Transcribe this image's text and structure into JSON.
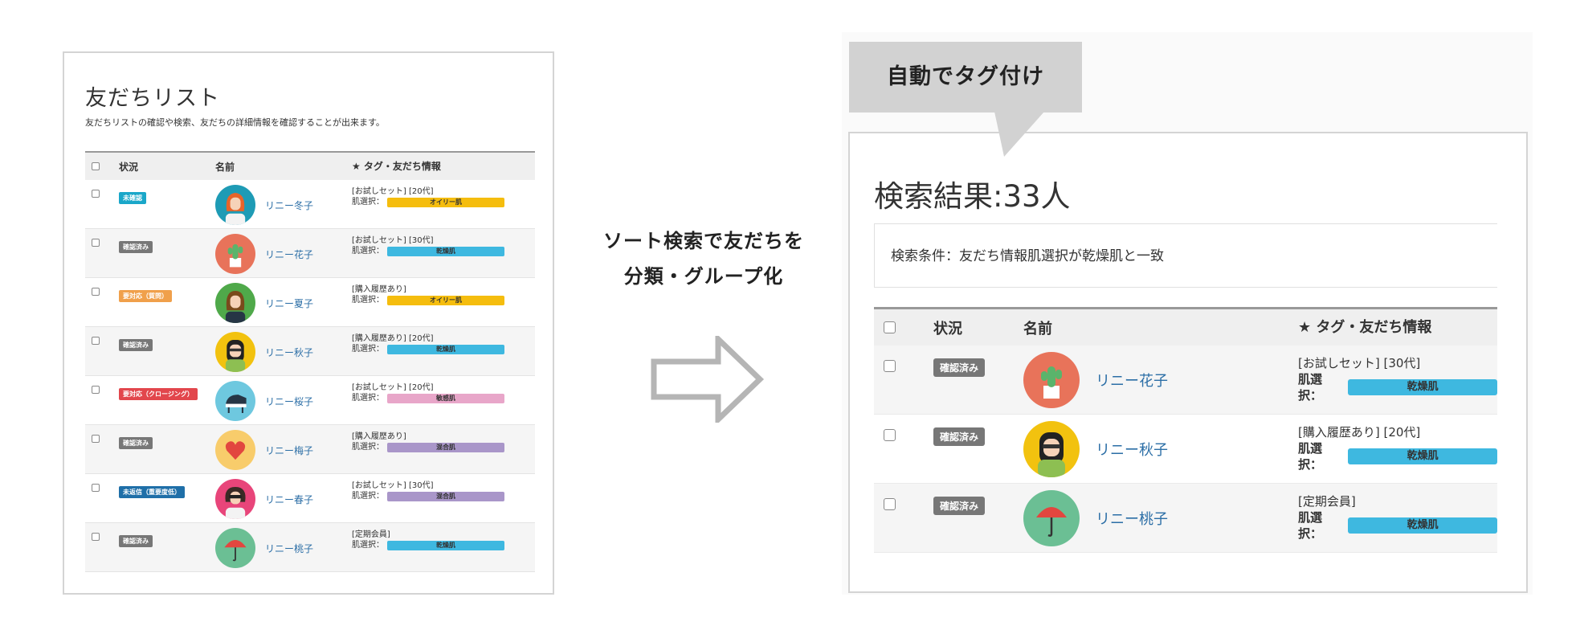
{
  "left": {
    "title": "友だちリスト",
    "description": "友だちリストの確認や検索、友だちの詳細情報を確認することが出来ます。",
    "headers": {
      "status": "状況",
      "name": "名前",
      "info": "★ タグ・友だち情報"
    },
    "skin_label": "肌選択：",
    "rows": [
      {
        "status": "未確認",
        "status_color": "#1aa7c9",
        "name": "リニー冬子",
        "tag": "[お試しセット] [20代]",
        "skin": "オイリー肌",
        "skin_color": "#f5bd0e",
        "avatar_color": "#1e9bb5",
        "avatar": "woman-orange-hair"
      },
      {
        "status": "確認済み",
        "status_color": "#777777",
        "name": "リニー花子",
        "tag": "[お試しセット] [30代]",
        "skin": "乾燥肌",
        "skin_color": "#3eb8e0",
        "avatar_color": "#e8735a",
        "avatar": "cactus"
      },
      {
        "status": "要対応（質問）",
        "status_color": "#f0a04b",
        "name": "リニー夏子",
        "tag": "[購入履歴あり]",
        "skin": "オイリー肌",
        "skin_color": "#f5bd0e",
        "avatar_color": "#4fa94a",
        "avatar": "woman-brown-hair"
      },
      {
        "status": "確認済み",
        "status_color": "#777777",
        "name": "リニー秋子",
        "tag": "[購入履歴あり] [20代]",
        "skin": "乾燥肌",
        "skin_color": "#3eb8e0",
        "avatar_color": "#f2c20f",
        "avatar": "woman-glasses"
      },
      {
        "status": "要対応（クロージング）",
        "status_color": "#e2464c",
        "name": "リニー桜子",
        "tag": "[お試しセット] [20代]",
        "skin": "敏感肌",
        "skin_color": "#e8a6c9",
        "avatar_color": "#6ec8df",
        "avatar": "piano"
      },
      {
        "status": "確認済み",
        "status_color": "#777777",
        "name": "リニー梅子",
        "tag": "[購入履歴あり]",
        "skin": "混合肌",
        "skin_color": "#a996c9",
        "avatar_color": "#f8cc6b",
        "avatar": "heart"
      },
      {
        "status": "未返信（重要度低）",
        "status_color": "#1f6fa8",
        "name": "リニー春子",
        "tag": "[お試しセット] [30代]",
        "skin": "混合肌",
        "skin_color": "#a996c9",
        "avatar_color": "#e8457a",
        "avatar": "woman-sunglasses"
      },
      {
        "status": "確認済み",
        "status_color": "#777777",
        "name": "リニー桃子",
        "tag": "[定期会員]",
        "skin": "乾燥肌",
        "skin_color": "#3eb8e0",
        "avatar_color": "#6bbf94",
        "avatar": "umbrella"
      }
    ]
  },
  "middle": {
    "line1": "ソート検索で友だちを",
    "line2": "分類・グループ化"
  },
  "right": {
    "callout": "自動でタグ付け",
    "result_title": "検索結果:33人",
    "condition": "検索条件：友だち情報肌選択が乾燥肌と一致",
    "headers": {
      "status": "状況",
      "name": "名前",
      "info": "★ タグ・友だち情報"
    },
    "skin_label": "肌選択：",
    "rows": [
      {
        "status": "確認済み",
        "name": "リニー花子",
        "tag": "[お試しセット] [30代]",
        "skin": "乾燥肌",
        "skin_color": "#3eb8e0",
        "avatar_color": "#e8735a",
        "avatar": "cactus"
      },
      {
        "status": "確認済み",
        "name": "リニー秋子",
        "tag": "[購入履歴あり] [20代]",
        "skin": "乾燥肌",
        "skin_color": "#3eb8e0",
        "avatar_color": "#f2c20f",
        "avatar": "woman-glasses"
      },
      {
        "status": "確認済み",
        "name": "リニー桃子",
        "tag": "[定期会員]",
        "skin": "乾燥肌",
        "skin_color": "#3eb8e0",
        "avatar_color": "#6bbf94",
        "avatar": "umbrella"
      }
    ]
  }
}
